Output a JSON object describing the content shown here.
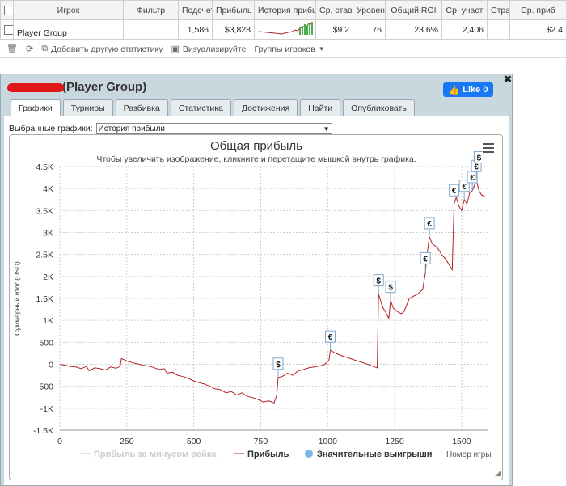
{
  "table": {
    "headers": [
      "Игрок",
      "Фильтр",
      "Подсчет",
      "Прибыль",
      "История прибы",
      "Ср. ставк",
      "Уровен",
      "Общий ROI",
      "Ср. участ",
      "Стра",
      "Ср. приб"
    ],
    "row": {
      "player": "Player Group",
      "filter": "",
      "count": "1,586",
      "profit": "$3,828",
      "avg_stake": "$9.2",
      "level": "76",
      "roi": "23.6%",
      "avg_participants": "2,406",
      "country": "",
      "avg_profit": "$2.4"
    }
  },
  "toolbar": {
    "add_stat": "Добавить другую статистику",
    "visualize": "Визуализируйте",
    "player_groups": "Группы игроков"
  },
  "panel": {
    "title": "(Player Group)",
    "like": "Like 0",
    "tabs": [
      "Графики",
      "Турниры",
      "Разбивка",
      "Статистика",
      "Достижения",
      "Найти",
      "Опубликовать"
    ],
    "selected_graphs_label": "Выбранные графики:",
    "selected_graph": "История прибыли"
  },
  "chart_data": {
    "type": "line",
    "title": "Общая прибыль",
    "subtitle": "Чтобы увеличить изображение, кликните и перетащите мышкой внутрь графика.",
    "ylabel": "Суммарный итог (USD)",
    "xlabel": "Номер игры",
    "xlim": [
      0,
      1600
    ],
    "ylim": [
      -1500,
      4500
    ],
    "x_ticks": [
      0,
      250,
      500,
      750,
      1000,
      1250,
      1500
    ],
    "y_ticks": [
      "-1.5K",
      "-1K",
      "-500",
      "0",
      "500",
      "1K",
      "1.5K",
      "2K",
      "2.5K",
      "3K",
      "3.5K",
      "4K",
      "4.5K"
    ],
    "legend": [
      "Прибыль за минусом рейка",
      "Прибыль",
      "Значительные выигрыши"
    ],
    "series": [
      {
        "name": "Прибыль",
        "color": "#b22222",
        "points": [
          [
            0,
            0
          ],
          [
            20,
            -20
          ],
          [
            40,
            -50
          ],
          [
            60,
            -60
          ],
          [
            80,
            -100
          ],
          [
            100,
            -50
          ],
          [
            110,
            -150
          ],
          [
            130,
            -80
          ],
          [
            150,
            -100
          ],
          [
            170,
            -130
          ],
          [
            190,
            -60
          ],
          [
            210,
            -90
          ],
          [
            225,
            -50
          ],
          [
            230,
            130
          ],
          [
            250,
            80
          ],
          [
            270,
            40
          ],
          [
            290,
            10
          ],
          [
            310,
            -20
          ],
          [
            330,
            -40
          ],
          [
            350,
            -70
          ],
          [
            370,
            -120
          ],
          [
            390,
            -100
          ],
          [
            400,
            -200
          ],
          [
            420,
            -180
          ],
          [
            440,
            -250
          ],
          [
            460,
            -280
          ],
          [
            480,
            -320
          ],
          [
            500,
            -380
          ],
          [
            520,
            -420
          ],
          [
            540,
            -450
          ],
          [
            560,
            -500
          ],
          [
            580,
            -560
          ],
          [
            600,
            -580
          ],
          [
            620,
            -650
          ],
          [
            640,
            -620
          ],
          [
            660,
            -700
          ],
          [
            680,
            -650
          ],
          [
            700,
            -730
          ],
          [
            720,
            -760
          ],
          [
            740,
            -800
          ],
          [
            760,
            -860
          ],
          [
            780,
            -830
          ],
          [
            800,
            -880
          ],
          [
            810,
            -700
          ],
          [
            815,
            -300
          ],
          [
            830,
            -280
          ],
          [
            850,
            -200
          ],
          [
            870,
            -250
          ],
          [
            890,
            -150
          ],
          [
            910,
            -120
          ],
          [
            930,
            -80
          ],
          [
            950,
            -60
          ],
          [
            970,
            -40
          ],
          [
            990,
            0
          ],
          [
            1005,
            100
          ],
          [
            1010,
            320
          ],
          [
            1030,
            250
          ],
          [
            1050,
            200
          ],
          [
            1070,
            160
          ],
          [
            1090,
            120
          ],
          [
            1110,
            80
          ],
          [
            1130,
            40
          ],
          [
            1150,
            0
          ],
          [
            1170,
            -50
          ],
          [
            1185,
            -80
          ],
          [
            1190,
            1600
          ],
          [
            1205,
            1300
          ],
          [
            1215,
            1200
          ],
          [
            1228,
            1050
          ],
          [
            1235,
            1450
          ],
          [
            1245,
            1280
          ],
          [
            1260,
            1200
          ],
          [
            1275,
            1150
          ],
          [
            1285,
            1200
          ],
          [
            1295,
            1350
          ],
          [
            1305,
            1500
          ],
          [
            1320,
            1550
          ],
          [
            1330,
            1580
          ],
          [
            1340,
            1620
          ],
          [
            1355,
            1700
          ],
          [
            1365,
            2100
          ],
          [
            1370,
            2450
          ],
          [
            1380,
            2900
          ],
          [
            1390,
            2750
          ],
          [
            1410,
            2650
          ],
          [
            1425,
            2500
          ],
          [
            1440,
            2400
          ],
          [
            1455,
            2250
          ],
          [
            1465,
            2150
          ],
          [
            1472,
            3650
          ],
          [
            1480,
            3800
          ],
          [
            1490,
            3600
          ],
          [
            1500,
            3500
          ],
          [
            1510,
            3750
          ],
          [
            1520,
            3650
          ],
          [
            1530,
            3900
          ],
          [
            1540,
            3950
          ],
          [
            1550,
            4100
          ],
          [
            1555,
            4200
          ],
          [
            1565,
            3950
          ],
          [
            1575,
            3850
          ],
          [
            1586,
            3828
          ]
        ]
      }
    ],
    "big_wins": [
      {
        "x": 815,
        "y": -300,
        "symbol": "$"
      },
      {
        "x": 1010,
        "y": 320,
        "symbol": "€"
      },
      {
        "x": 1190,
        "y": 1600,
        "symbol": "$"
      },
      {
        "x": 1235,
        "y": 1450,
        "symbol": "$"
      },
      {
        "x": 1365,
        "y": 2100,
        "symbol": "€"
      },
      {
        "x": 1380,
        "y": 2900,
        "symbol": "€"
      },
      {
        "x": 1472,
        "y": 3650,
        "symbol": "€"
      },
      {
        "x": 1510,
        "y": 3750,
        "symbol": "€"
      },
      {
        "x": 1540,
        "y": 3950,
        "symbol": "€"
      },
      {
        "x": 1555,
        "y": 4200,
        "symbol": "€"
      },
      {
        "x": 1565,
        "y": 4400,
        "symbol": "$"
      }
    ]
  }
}
